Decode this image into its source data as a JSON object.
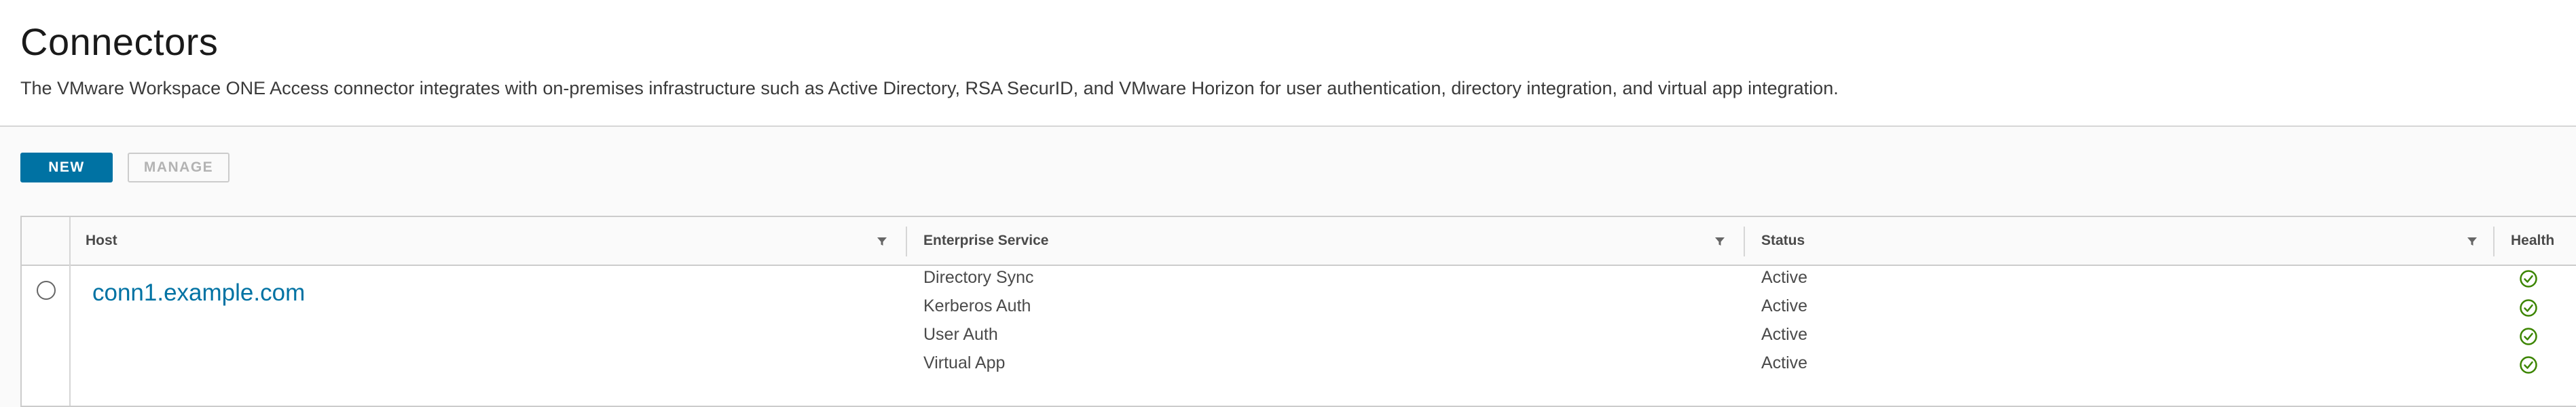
{
  "header": {
    "title": "Connectors",
    "description": "The VMware Workspace ONE Access connector integrates with on-premises infrastructure such as Active Directory, RSA SecurID, and VMware Horizon for user authentication, directory integration, and virtual app integration."
  },
  "toolbar": {
    "new_label": "NEW",
    "manage_label": "MANAGE"
  },
  "table": {
    "columns": {
      "host": "Host",
      "enterprise_service": "Enterprise Service",
      "status": "Status",
      "health": "Health"
    },
    "rows": [
      {
        "host": "conn1.example.com",
        "services": [
          {
            "name": "Directory Sync",
            "status": "Active"
          },
          {
            "name": "Kerberos Auth",
            "status": "Active"
          },
          {
            "name": "User Auth",
            "status": "Active"
          },
          {
            "name": "Virtual App",
            "status": "Active"
          }
        ]
      }
    ]
  },
  "colors": {
    "accent": "#0072a3",
    "health_ok": "#3c8500"
  },
  "icons": {
    "filter": "filter-icon",
    "health": "check-circle-icon",
    "select": "radio-icon"
  }
}
